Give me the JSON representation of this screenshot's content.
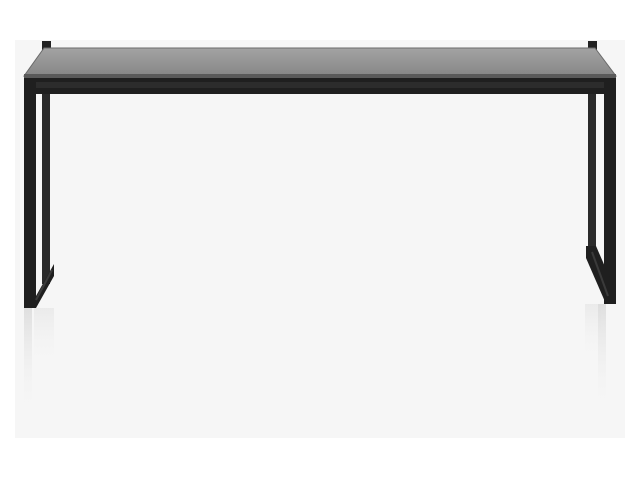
{
  "photo": {
    "subject": "coffee-table",
    "colors": {
      "backdrop": "#f6f6f6",
      "glass": "#8e8e8e",
      "glass_edge": "#5a5a5a",
      "frame": "#1f1f1f",
      "reflection": "#e9e9e9"
    }
  }
}
